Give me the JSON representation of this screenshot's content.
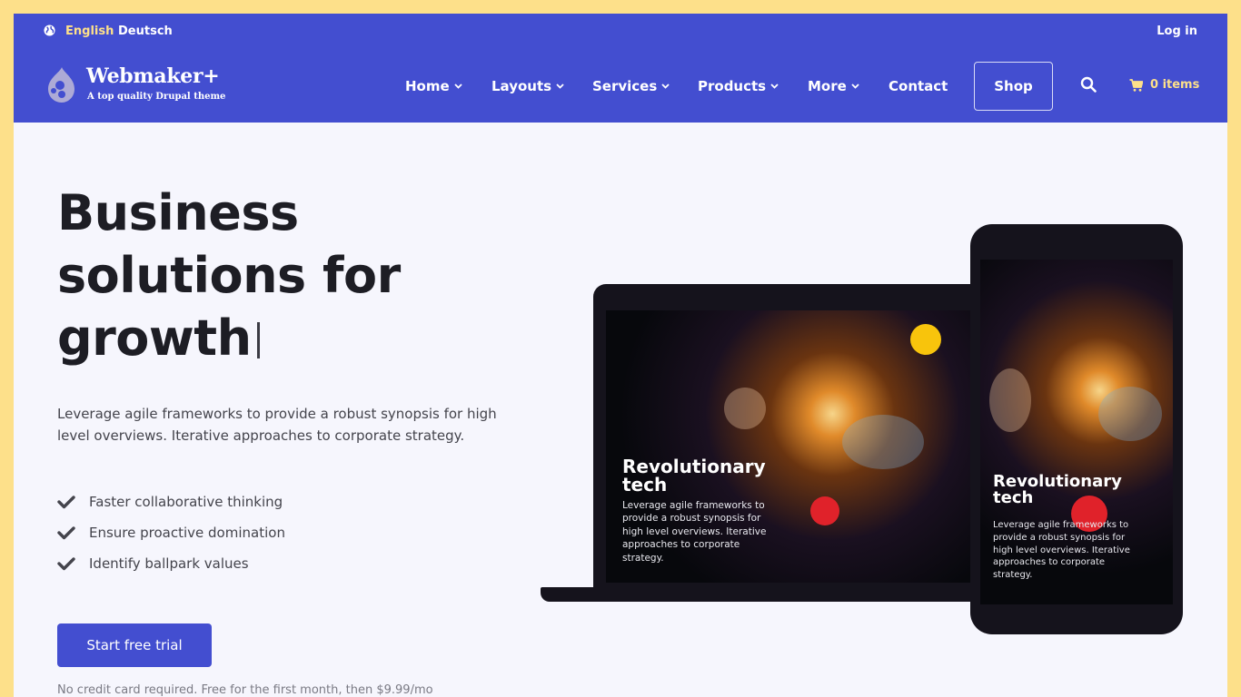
{
  "languages": {
    "english": "English",
    "deutsch": "Deutsch"
  },
  "account": {
    "login_label": "Log in"
  },
  "brand": {
    "name": "Webmaker+",
    "tagline": "A top quality Drupal theme"
  },
  "nav": {
    "items": [
      {
        "label": "Home",
        "has_dropdown": true
      },
      {
        "label": "Layouts",
        "has_dropdown": true
      },
      {
        "label": "Services",
        "has_dropdown": true
      },
      {
        "label": "Products",
        "has_dropdown": true
      },
      {
        "label": "More",
        "has_dropdown": true
      },
      {
        "label": "Contact",
        "has_dropdown": false
      }
    ],
    "shop_label": "Shop",
    "cart_label": "0 items"
  },
  "hero": {
    "title_lines": [
      "Business",
      "solutions for",
      "growth"
    ],
    "description": "Leverage agile frameworks to provide a robust synopsis for high level overviews. Iterative approaches to corporate strategy.",
    "features": [
      "Faster collaborative thinking",
      "Ensure proactive domination",
      "Identify ballpark values"
    ],
    "cta_label": "Start free trial",
    "cta_note": "No credit card required. Free for the first month, then $9.99/mo"
  },
  "mockup": {
    "heading_line1": "Revolutionary",
    "heading_line2": "tech",
    "body_lines": [
      "Leverage agile frameworks to",
      "provide a robust synopsis for",
      "high level overviews. Iterative",
      "approaches to corporate",
      "strategy."
    ]
  },
  "colors": {
    "header_bg": "#434ed0",
    "accent_yellow": "#fde08a",
    "page_bg": "#f6f6fd",
    "device_dark": "#15131c"
  }
}
